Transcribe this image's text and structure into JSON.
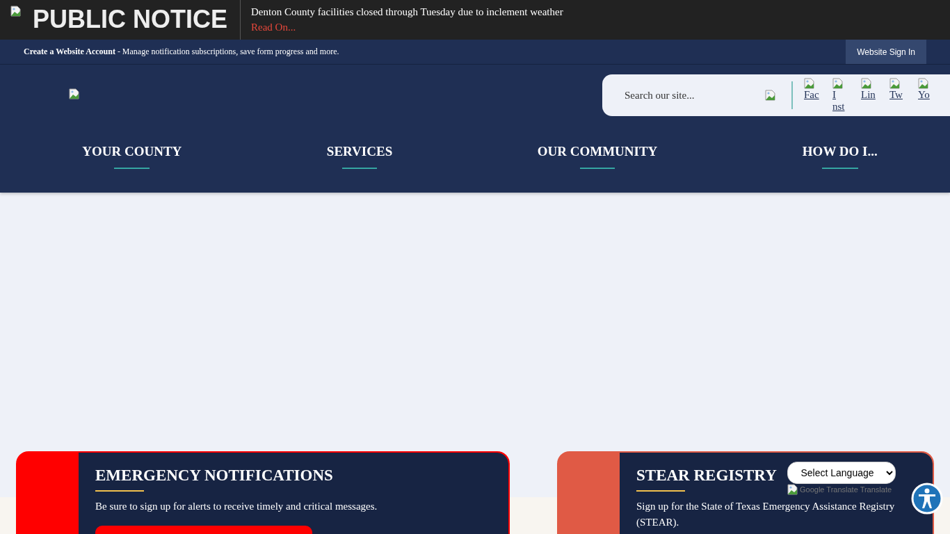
{
  "notice": {
    "title": "PUBLIC NOTICE",
    "message": "Denton County facilities closed through Tuesday due to inclement weather",
    "link": "Read On..."
  },
  "account_bar": {
    "text": "**Create a Website Account** - Manage notification subscriptions, save form progress and more.",
    "sign_in": "Website Sign In"
  },
  "search": {
    "placeholder": "Search our site..."
  },
  "social_links": [
    {
      "label": "Fac"
    },
    {
      "label": "I nst"
    },
    {
      "label": "Lin"
    },
    {
      "label": "Tw"
    },
    {
      "label": "Yo"
    }
  ],
  "nav": [
    {
      "label": "YOUR COUNTY"
    },
    {
      "label": "SERVICES"
    },
    {
      "label": "OUR COMMUNITY"
    },
    {
      "label": "HOW DO I..."
    }
  ],
  "cards": [
    {
      "title": "EMERGENCY NOTIFICATIONS",
      "text": "Be sure to sign up for alerts to receive timely and critical messages.",
      "color": "#ff0000",
      "has_button": true
    },
    {
      "title": "STEAR REGISTRY",
      "text": "Sign up for the State of Texas Emergency Assistance Registry (STEAR).",
      "color": "#e05a45",
      "has_button": false
    }
  ],
  "translate": {
    "select": "Select Language",
    "credit": "Google Translate Translate"
  }
}
